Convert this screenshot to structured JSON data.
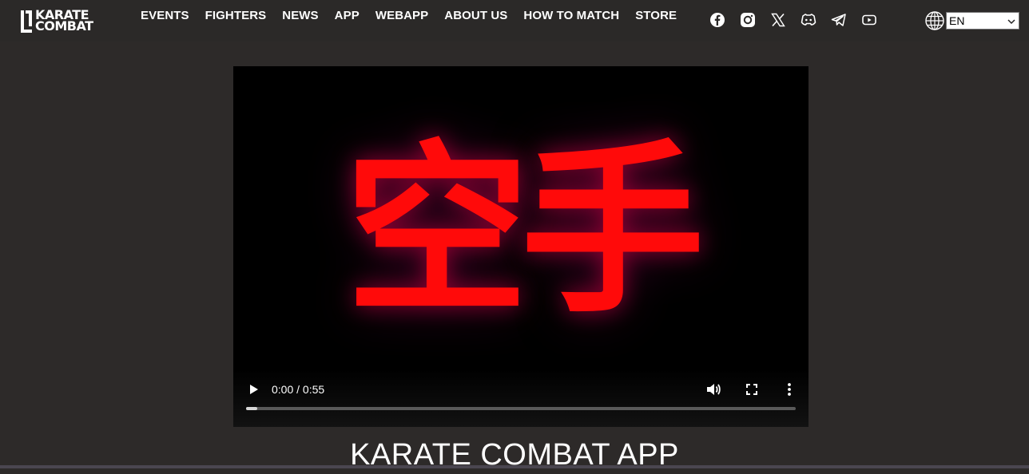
{
  "header": {
    "logo": {
      "line1": "KARATE",
      "line2": "COMBAT"
    },
    "nav": [
      {
        "label": "EVENTS"
      },
      {
        "label": "FIGHTERS"
      },
      {
        "label": "NEWS"
      },
      {
        "label": "APP"
      },
      {
        "label": "WEBAPP"
      },
      {
        "label": "ABOUT US"
      },
      {
        "label": "HOW TO MATCH"
      },
      {
        "label": "STORE"
      }
    ],
    "socials": [
      "facebook-icon",
      "instagram-icon",
      "x-icon",
      "discord-icon",
      "telegram-icon",
      "youtube-icon"
    ],
    "language": {
      "selected": "EN"
    }
  },
  "video": {
    "kanji": "空手",
    "time": "0:00 / 0:55",
    "progress": 0.02,
    "accent": "#ff0a0a"
  },
  "section": {
    "title": "KARATE COMBAT APP"
  },
  "colors": {
    "page_bg": "#2d2a29",
    "header_bg": "#2b2928",
    "text": "#ffffff"
  }
}
